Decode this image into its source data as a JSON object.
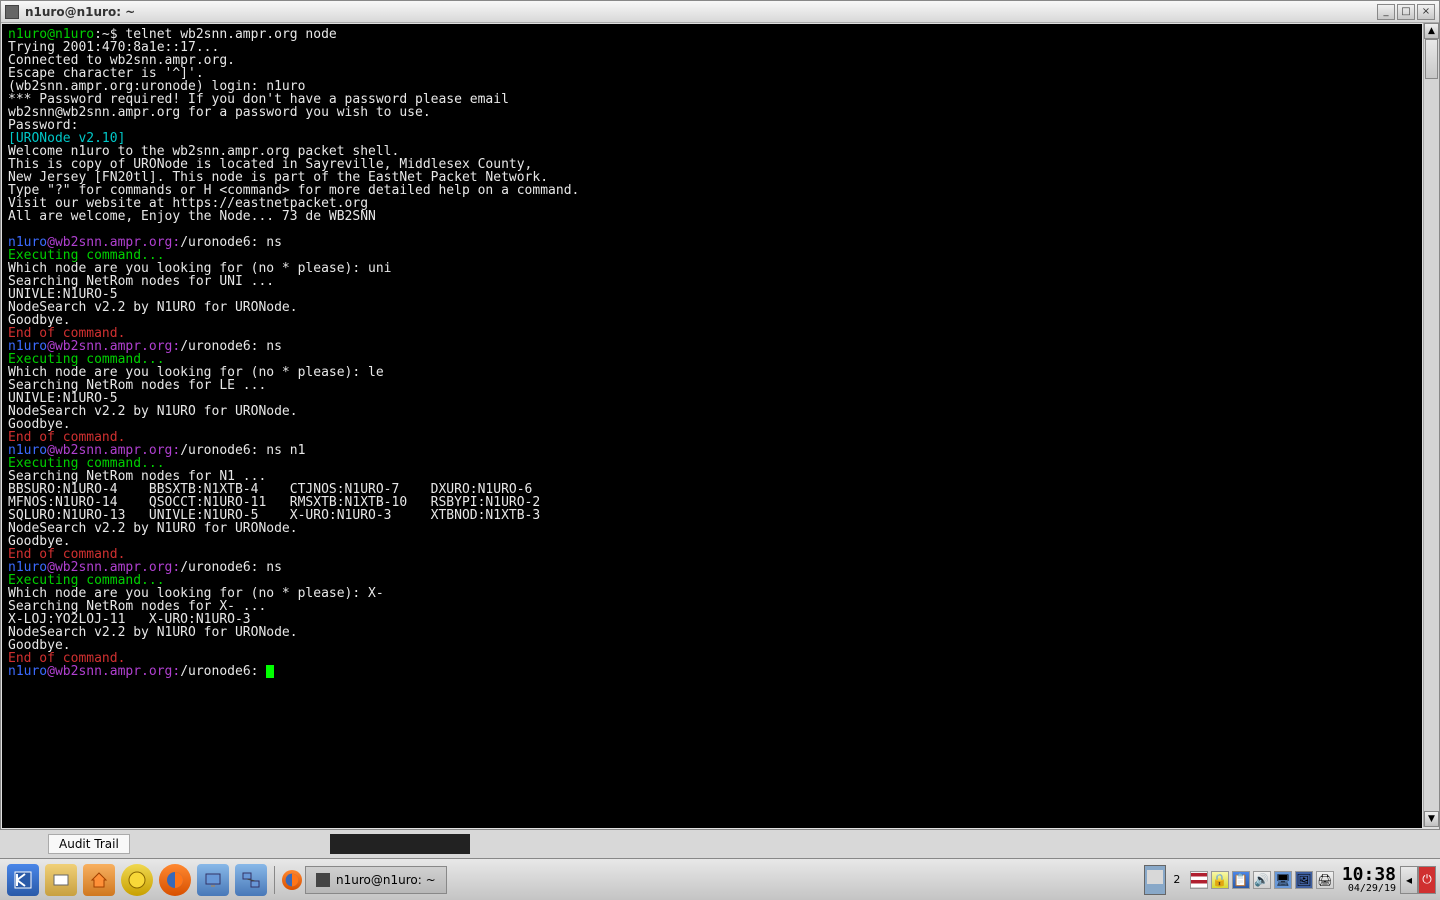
{
  "window": {
    "title": "n1uro@n1uro: ~"
  },
  "prompt": {
    "shell_user": "n1uro@n1uro",
    "shell_path": ":~$ ",
    "shell_cmd": "telnet wb2snn.ampr.org node",
    "node_user": "n1uro",
    "node_host": "@wb2snn.ampr.org:",
    "node_path": "/uronode6: "
  },
  "lines": {
    "trying": "Trying 2001:470:8a1e::17...",
    "connected": "Connected to wb2snn.ampr.org.",
    "escape": "Escape character is '^]'.",
    "login": "(wb2snn.ampr.org:uronode) login: n1uro",
    "pw_req": "*** Password required! If you don't have a password please email",
    "pw_req2": "wb2snn@wb2snn.ampr.org for a password you wish to use.",
    "pw_prompt": "Password:",
    "uronode_ver": "[URONode v2.10]",
    "welcome": "Welcome n1uro to the wb2snn.ampr.org packet shell.",
    "loc1": "This is copy of URONode is located in Sayreville, Middlesex County,",
    "loc2": "New Jersey [FN20tl]. This node is part of the EastNet Packet Network.",
    "help": "Type \"?\" for commands or H <command> for more detailed help on a command.",
    "website": "Visit our website at https://eastnetpacket.org",
    "welcome2": "All are welcome, Enjoy the Node... 73 de WB2SNN",
    "exec": "Executing command...",
    "which_uni": "Which node are you looking for (no * please): uni",
    "search_uni": "Searching NetRom nodes for UNI ...",
    "res_uni": "UNIVLE:N1URO-5",
    "nodesearch": "NodeSearch v2.2 by N1URO for URONode.",
    "goodbye": "Goodbye.",
    "eoc": "End of command.",
    "which_le": "Which node are you looking for (no * please): le",
    "search_le": "Searching NetRom nodes for LE ...",
    "res_le": "UNIVLE:N1URO-5",
    "cmd_ns": "ns",
    "cmd_ns_n1": "ns n1",
    "search_n1": "Searching NetRom nodes for N1 ...",
    "n1_r1": "BBSURO:N1URO-4    BBSXTB:N1XTB-4    CTJNOS:N1URO-7    DXURO:N1URO-6",
    "n1_r2": "MFNOS:N1URO-14    QSOCCT:N1URO-11   RMSXTB:N1XTB-10   RSBYPI:N1URO-2",
    "n1_r3": "SQLURO:N1URO-13   UNIVLE:N1URO-5    X-URO:N1URO-3     XTBNOD:N1XTB-3",
    "which_x": "Which node are you looking for (no * please): X-",
    "search_x": "Searching NetRom nodes for X- ...",
    "res_x": "X-LOJ:YO2LOJ-11   X-URO:N1URO-3"
  },
  "backrow": {
    "audit": "Audit Trail"
  },
  "taskbar": {
    "task1": "n1uro@n1uro: ~",
    "pager": "2",
    "clock_time": "10:38",
    "clock_date": "04/29/19"
  }
}
